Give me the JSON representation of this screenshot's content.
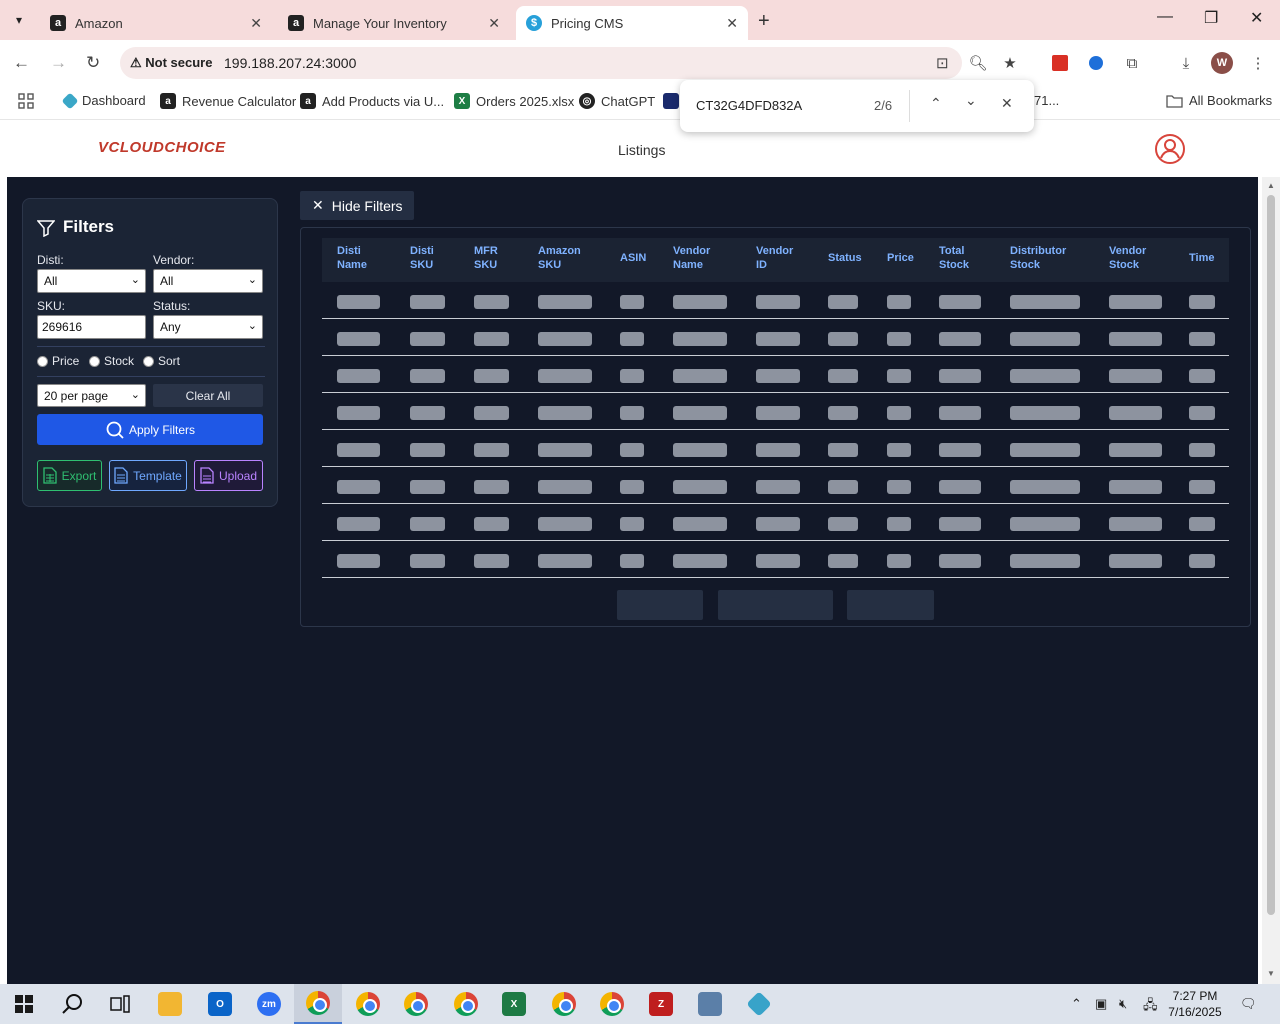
{
  "browser": {
    "tabs": [
      {
        "title": "Amazon",
        "favicon": "amazon-icon"
      },
      {
        "title": "Manage Your Inventory",
        "favicon": "amazon-icon"
      },
      {
        "title": "Pricing CMS",
        "favicon": "dollar-icon"
      }
    ],
    "address": {
      "security": "Not secure",
      "url": "199.188.207.24:3000"
    },
    "profile_initial": "W",
    "bookmarks": [
      {
        "label": "Dashboard",
        "icon": "dashboard-icon"
      },
      {
        "label": "Revenue Calculator",
        "icon": "amazon-icon"
      },
      {
        "label": "Add Products via U...",
        "icon": "amazon-icon"
      },
      {
        "label": "Orders 2025.xlsx",
        "icon": "excel-icon"
      },
      {
        "label": "ChatGPT",
        "icon": "chatgpt-icon"
      },
      {
        "label": "All Bookmarks",
        "icon": "folder-icon"
      }
    ],
    "bookmark_truncated": "71...",
    "find": {
      "query": "CT32G4DFD832A",
      "count": "2/6"
    }
  },
  "app": {
    "logo": "VCLOUDCHOICE",
    "nav": {
      "listings": "Listings"
    },
    "filters": {
      "title": "Filters",
      "disti_label": "Disti:",
      "disti_value": "All",
      "vendor_label": "Vendor:",
      "vendor_value": "All",
      "sku_label": "SKU:",
      "sku_value": "269616",
      "status_label": "Status:",
      "status_value": "Any",
      "radios": [
        "Price",
        "Stock",
        "Sort"
      ],
      "per_page": "20 per page",
      "clear_all": "Clear All",
      "apply": "Apply Filters",
      "export": "Export",
      "template": "Template",
      "upload": "Upload"
    },
    "hide_filters": "Hide Filters",
    "table": {
      "columns": [
        [
          "Disti",
          "Name"
        ],
        [
          "Disti",
          "SKU"
        ],
        [
          "MFR",
          "SKU"
        ],
        [
          "Amazon",
          "SKU"
        ],
        [
          "ASIN",
          ""
        ],
        [
          "Vendor",
          "Name"
        ],
        [
          "Vendor",
          "ID"
        ],
        [
          "Status",
          ""
        ],
        [
          "Price",
          ""
        ],
        [
          "Total",
          "Stock"
        ],
        [
          "Distributor",
          "Stock"
        ],
        [
          "Vendor",
          "Stock"
        ],
        [
          "Time",
          ""
        ]
      ],
      "loading_rows": 8
    }
  },
  "taskbar": {
    "time": "7:27 PM",
    "date": "7/16/2025"
  },
  "colors": {
    "app_bg": "#121828",
    "panel_bg": "#1b2435",
    "accent_blue": "#1f58e6",
    "header_text": "#7fb2ff",
    "skeleton": "#8d939f",
    "export_green": "#2fbf71",
    "template_blue": "#6fa8ff",
    "upload_purple": "#b983ff"
  }
}
